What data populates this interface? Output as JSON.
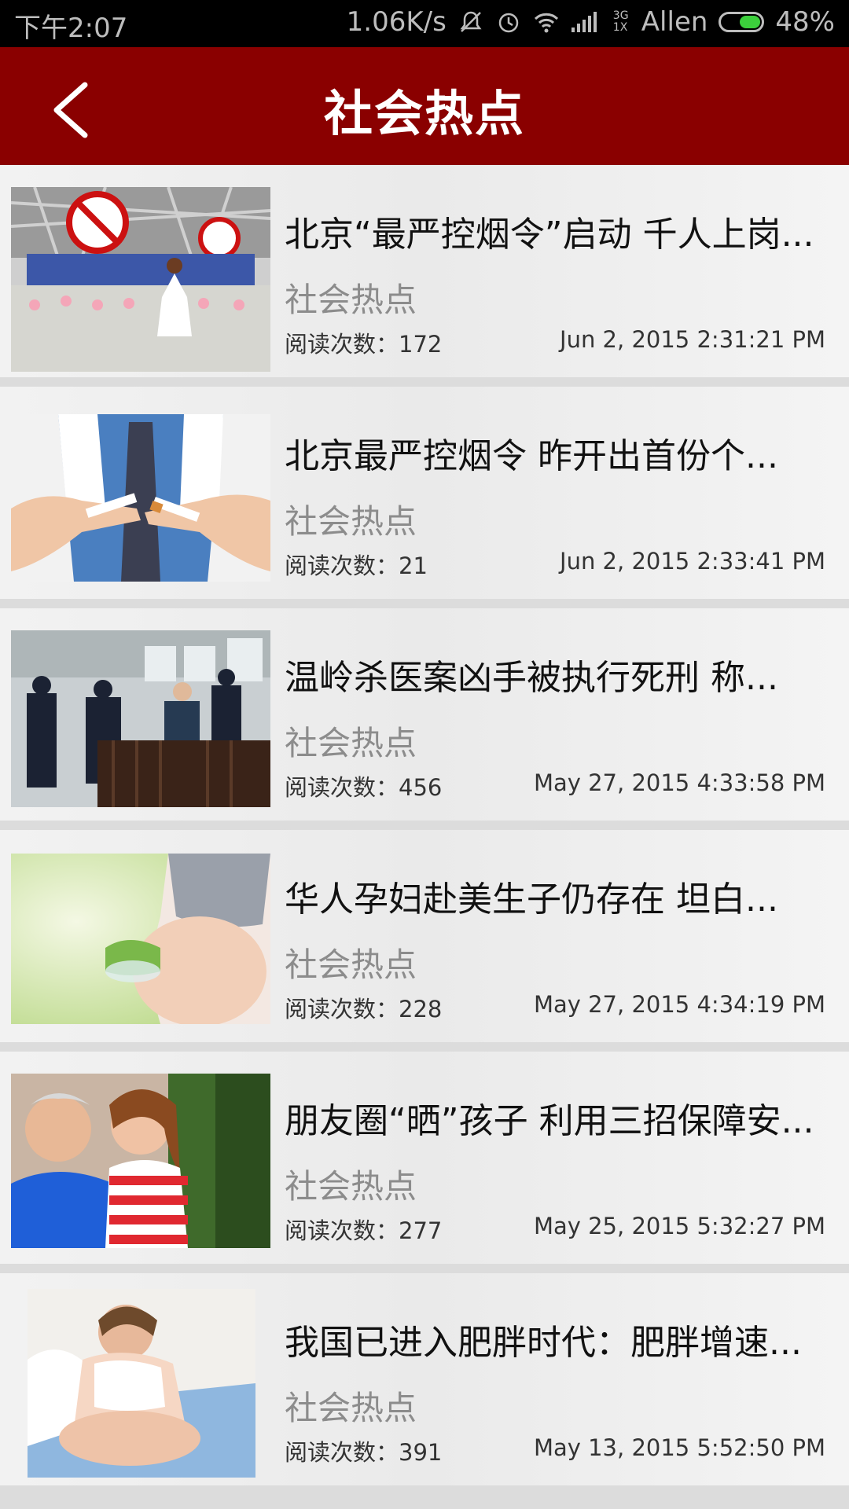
{
  "status_bar": {
    "time": "下午2:07",
    "speed": "1.06K/s",
    "network": "3G 1X",
    "carrier": "Allen",
    "battery": "48%"
  },
  "header": {
    "title": "社会热点",
    "back_icon": "chevron-left-icon"
  },
  "items": [
    {
      "title": "北京“最严控烟令”启动 千人上岗...",
      "category": "社会热点",
      "reads": "阅读次数：172",
      "date": "Jun 2, 2015 2:31:21 PM",
      "image": "stadium-no-smoking-children"
    },
    {
      "title": "北京最严控烟令 昨开出首份个...",
      "category": "社会热点",
      "reads": "阅读次数：21",
      "date": "Jun 2, 2015 2:33:41 PM",
      "image": "hands-breaking-cigarette"
    },
    {
      "title": "温岭杀医案凶手被执行死刑 称...",
      "category": "社会热点",
      "reads": "阅读次数：456",
      "date": "May 27, 2015 4:33:58 PM",
      "image": "courtroom-police"
    },
    {
      "title": "华人孕妇赴美生子仍存在 坦白...",
      "category": "社会热点",
      "reads": "阅读次数：228",
      "date": "May 27, 2015 4:34:19 PM",
      "image": "pregnant-woman-salad"
    },
    {
      "title": "朋友圈“晒”孩子 利用三招保障安...",
      "category": "社会热点",
      "reads": "阅读次数：277",
      "date": "May 25, 2015 5:32:27 PM",
      "image": "grandfather-girl"
    },
    {
      "title": "我国已进入肥胖时代：肥胖增速...",
      "category": "社会热点",
      "reads": "阅读次数：391",
      "date": "May 13, 2015 5:52:50 PM",
      "image": "overweight-woman"
    }
  ]
}
